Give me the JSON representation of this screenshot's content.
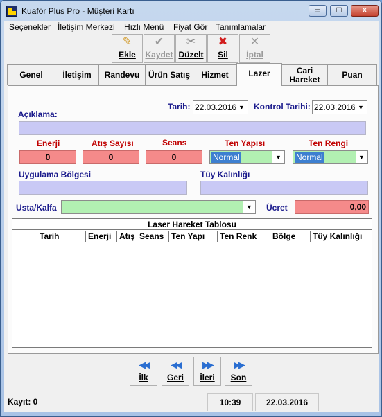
{
  "window": {
    "title": "Kuaför Plus Pro - Müşteri Kartı",
    "minimize_glyph": "▭",
    "maximize_glyph": "☐",
    "close_glyph": "X"
  },
  "menu": [
    "Seçenekler",
    "İletişim Merkezi",
    "Hızlı Menü",
    "Fiyat Gör",
    "Tanımlamalar"
  ],
  "toolbar": [
    {
      "label": "Ekle",
      "icon": "pencil-icon",
      "glyph": "✎",
      "enabled": true
    },
    {
      "label": "Kaydet",
      "icon": "checkmark-icon",
      "glyph": "✔",
      "enabled": false
    },
    {
      "label": "Düzelt",
      "icon": "tools-icon",
      "glyph": "✂",
      "enabled": true
    },
    {
      "label": "Sil",
      "icon": "delete-x-icon",
      "glyph": "✖",
      "enabled": true
    },
    {
      "label": "İptal",
      "icon": "cancel-x-icon",
      "glyph": "✕",
      "enabled": false
    }
  ],
  "tabs": [
    {
      "label": "Genel",
      "active": false
    },
    {
      "label": "İletişim",
      "active": false
    },
    {
      "label": "Randevu",
      "active": false
    },
    {
      "label": "Ürün Satış",
      "active": false
    },
    {
      "label": "Hizmet",
      "active": false
    },
    {
      "label": "Lazer",
      "active": true
    },
    {
      "label": "Cari Hareket",
      "active": false
    },
    {
      "label": "Puan",
      "active": false
    }
  ],
  "form": {
    "aciklama_label": "Açıklama:",
    "tarih_label": "Tarih:",
    "tarih_value": "22.03.2016",
    "kontrol_tarihi_label": "Kontrol Tarihi:",
    "kontrol_tarihi_value": "22.03.2016",
    "enerji_label": "Enerji",
    "enerji_value": "0",
    "atis_sayisi_label": "Atış Sayısı",
    "atis_sayisi_value": "0",
    "seans_label": "Seans",
    "seans_value": "0",
    "ten_yapisi_label": "Ten Yapısı",
    "ten_yapisi_value": "Normal",
    "ten_rengi_label": "Ten Rengi",
    "ten_rengi_value": "Normal",
    "uygulama_bolgesi_label": "Uygulama Bölgesi",
    "tuy_kalinligi_label": "Tüy Kalınlığı",
    "usta_kalfa_label": "Usta/Kalfa",
    "ucret_label": "Ücret",
    "ucret_value": "0,00"
  },
  "grid": {
    "title": "Laser Hareket Tablosu",
    "columns": [
      "",
      "Tarih",
      "Enerji",
      "Atış",
      "Seans",
      "Ten Yapı",
      "Ten Renk",
      "Bölge",
      "Tüy Kalınlığı"
    ]
  },
  "navigation": [
    {
      "label": "İlk",
      "icon": "first-record-icon",
      "glyph": "◀◀"
    },
    {
      "label": "Geri",
      "icon": "previous-record-icon",
      "glyph": "◀◀"
    },
    {
      "label": "İleri",
      "icon": "next-record-icon",
      "glyph": "▶▶"
    },
    {
      "label": "Son",
      "icon": "last-record-icon",
      "glyph": "▶▶"
    }
  ],
  "status": {
    "kayit": "Kayıt: 0",
    "time": "10:39",
    "date": "22.03.2016"
  },
  "colors": {
    "required_field": "#f58a8a",
    "info_field": "#c9c9f5",
    "combo_highlight": "#b2f0b2",
    "label_blue": "#1a1a8c",
    "selection": "#3d7fd0"
  },
  "combo_arrow": "▼"
}
